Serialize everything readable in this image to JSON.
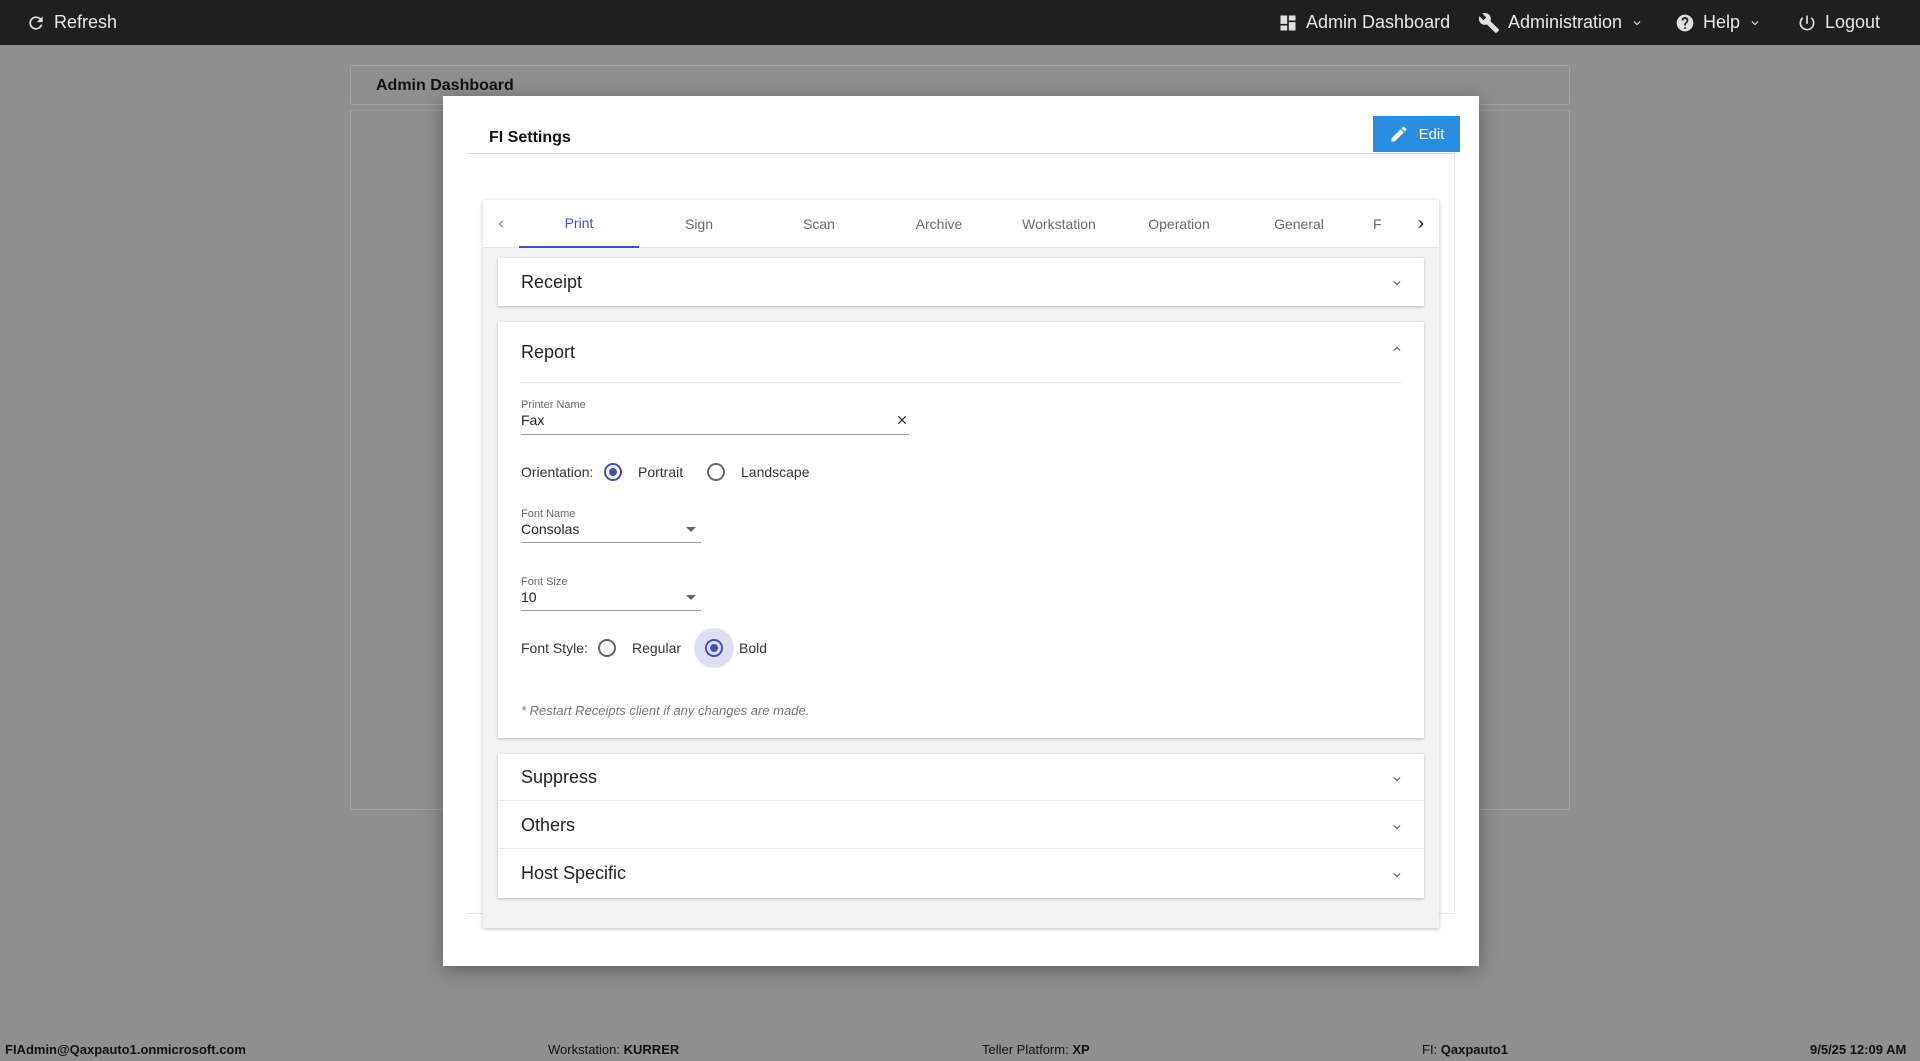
{
  "topbar": {
    "refresh_label": "Refresh",
    "admin_dashboard_label": "Admin Dashboard",
    "administration_label": "Administration",
    "help_label": "Help",
    "logout_label": "Logout"
  },
  "background": {
    "page_title": "Admin Dashboard"
  },
  "modal": {
    "title": "FI Settings",
    "edit_label": "Edit",
    "tabs": [
      {
        "label": "Print",
        "active": true
      },
      {
        "label": "Sign"
      },
      {
        "label": "Scan"
      },
      {
        "label": "Archive"
      },
      {
        "label": "Workstation"
      },
      {
        "label": "Operation"
      },
      {
        "label": "General"
      },
      {
        "label": "F"
      }
    ],
    "sections": {
      "receipt": "Receipt",
      "report": "Report",
      "suppress": "Suppress",
      "others": "Others",
      "host_specific": "Host Specific"
    },
    "report": {
      "printer_name_label": "Printer Name",
      "printer_name_value": "Fax",
      "orientation_label": "Orientation:",
      "orientation_options": [
        "Portrait",
        "Landscape"
      ],
      "orientation_selected": "Portrait",
      "font_name_label": "Font Name",
      "font_name_value": "Consolas",
      "font_size_label": "Font Size",
      "font_size_value": "10",
      "font_style_label": "Font Style:",
      "font_style_options": [
        "Regular",
        "Bold"
      ],
      "font_style_selected": "Bold",
      "note": "* Restart Receipts client if any changes are made."
    }
  },
  "statusbar": {
    "user": "FIAdmin@Qaxpauto1.onmicrosoft.com",
    "workstation_label": "Workstation:",
    "workstation_value": "KURRER",
    "teller_platform_label": "Teller Platform:",
    "teller_platform_value": "XP",
    "fi_label": "FI:",
    "fi_value": "Qaxpauto1",
    "datetime": "9/5/25 12:09 AM"
  },
  "colors": {
    "accent": "#3f51b5",
    "edit_button": "#2b8de0",
    "topbar": "#1f1f1f",
    "overlay": "#8f8f8f"
  }
}
